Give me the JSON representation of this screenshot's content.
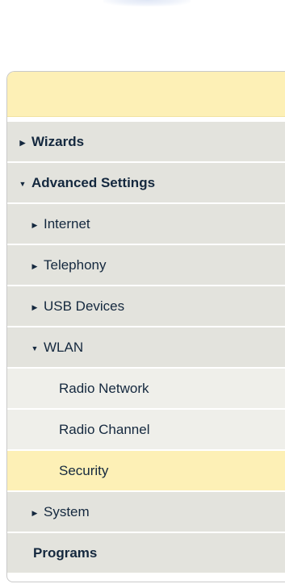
{
  "menu": {
    "items": [
      {
        "label": "Wizards",
        "icon": "triangle-right-icon"
      },
      {
        "label": "Advanced Settings",
        "icon": "triangle-down-icon"
      },
      {
        "label": "Internet",
        "icon": "triangle-right-icon"
      },
      {
        "label": "Telephony",
        "icon": "triangle-right-icon"
      },
      {
        "label": "USB Devices",
        "icon": "triangle-right-icon"
      },
      {
        "label": "WLAN",
        "icon": "triangle-down-icon"
      },
      {
        "label": "Radio Network"
      },
      {
        "label": "Radio Channel"
      },
      {
        "label": "Security",
        "active": true
      },
      {
        "label": "System",
        "icon": "triangle-right-icon"
      },
      {
        "label": "Programs"
      }
    ]
  },
  "colors": {
    "header_background": "#fdf0b6",
    "active_item_background": "#fdf0b6",
    "item_background": "#e3e3dd",
    "subitem_background": "#efefea",
    "text": "#14283e"
  },
  "icons": {
    "collapsed_glyph": "▶",
    "expanded_glyph": "▼"
  }
}
